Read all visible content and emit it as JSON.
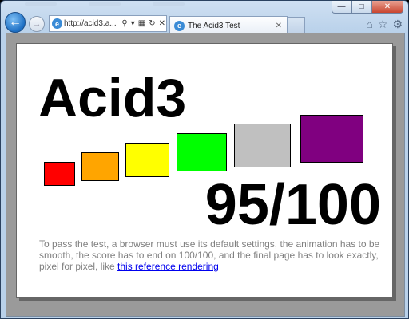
{
  "browser": {
    "address": "http://acid3.a...",
    "tab_title": "The Acid3 Test",
    "icons": {
      "back": "back-arrow-icon",
      "forward": "forward-arrow-icon",
      "site": "ie-page-icon",
      "search": "search-icon",
      "compat": "compatibility-view-icon",
      "refresh": "refresh-icon",
      "stop": "stop-icon",
      "home": "home-icon",
      "favorites": "favorites-star-icon",
      "tools": "gear-icon"
    }
  },
  "page": {
    "title": "Acid3",
    "score": "95/100",
    "description": "To pass the test, a browser must use its default settings, the animation has to be smooth, the score has to end on 100/100, and the final page has to look exactly, pixel for pixel, like ",
    "link_text": "this reference rendering",
    "boxes": [
      {
        "name": "red-box",
        "color": "#ff0000"
      },
      {
        "name": "orange-box",
        "color": "#ffa500"
      },
      {
        "name": "yellow-box",
        "color": "#ffff00"
      },
      {
        "name": "lime-box",
        "color": "#00ff00"
      },
      {
        "name": "silver-box",
        "color": "#c0c0c0"
      },
      {
        "name": "purple-box",
        "color": "#800080"
      }
    ]
  }
}
